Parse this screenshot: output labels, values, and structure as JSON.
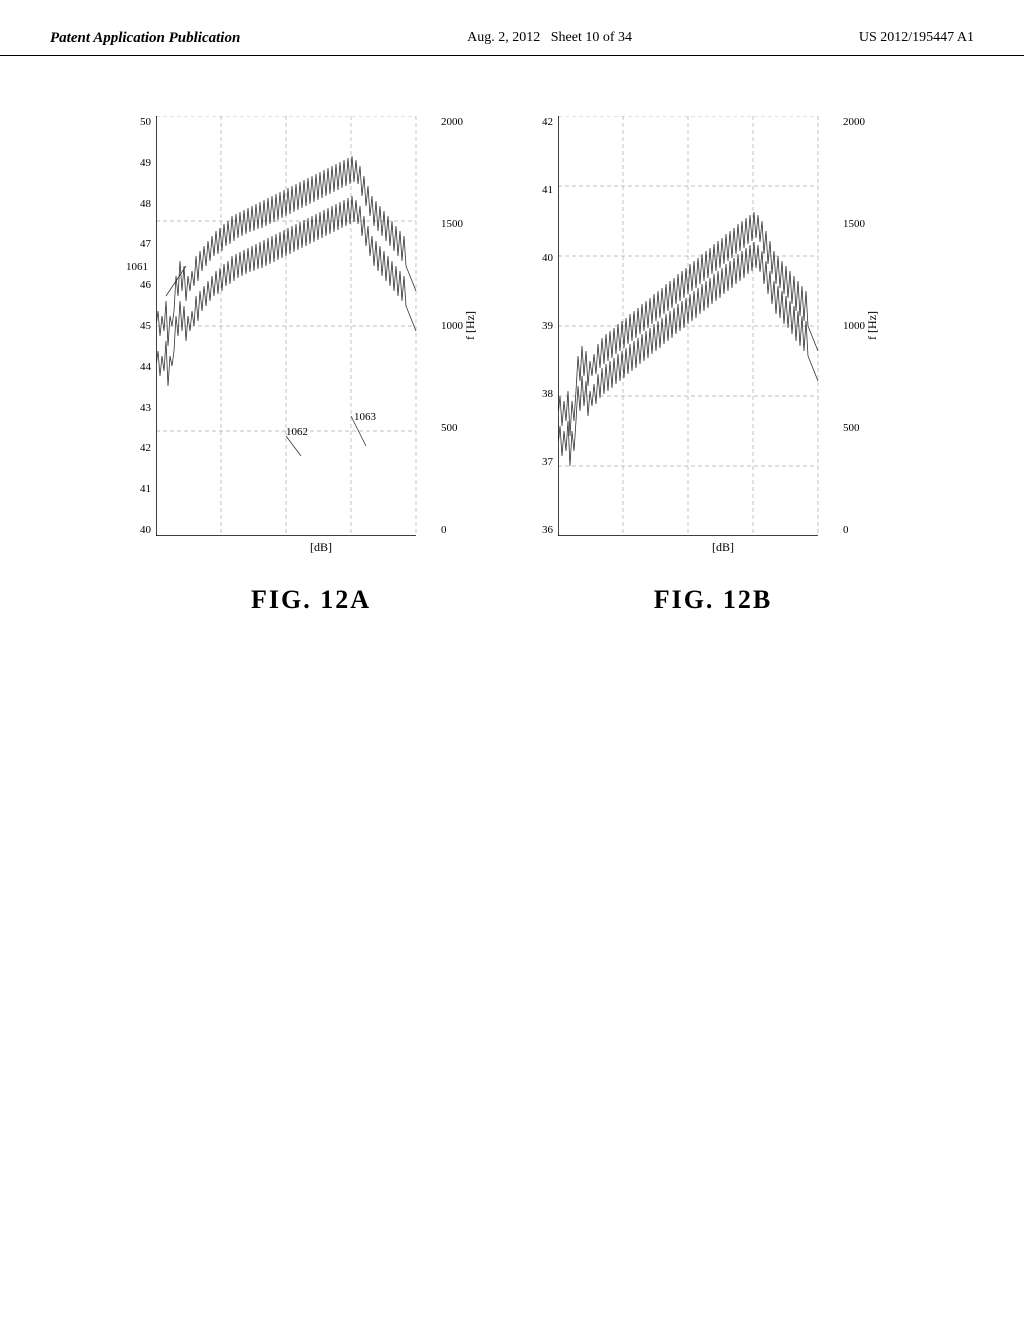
{
  "header": {
    "left": "Patent Application Publication",
    "center": "Aug. 2, 2012",
    "sheet": "Sheet 10 of 34",
    "right": "US 2012/195447 A1"
  },
  "figureA": {
    "label": "FIG. 12A",
    "xAxisTicks": [
      "50",
      "49",
      "48",
      "47",
      "46",
      "45",
      "44",
      "43",
      "42",
      "41",
      "40"
    ],
    "xAxisUnit": "[dB]",
    "yAxisTicks": [
      "2000",
      "1500",
      "1000",
      "500",
      "0"
    ],
    "yAxisLabel": "f [Hz]",
    "annotations": [
      "1061",
      "1062",
      "1063"
    ]
  },
  "figureB": {
    "label": "FIG. 12B",
    "xAxisTicks": [
      "42",
      "41",
      "40",
      "39",
      "38",
      "37",
      "36"
    ],
    "xAxisUnit": "[dB]",
    "yAxisTicks": [
      "2000",
      "1500",
      "1000",
      "500",
      "0"
    ],
    "yAxisLabel": "f [Hz]"
  }
}
